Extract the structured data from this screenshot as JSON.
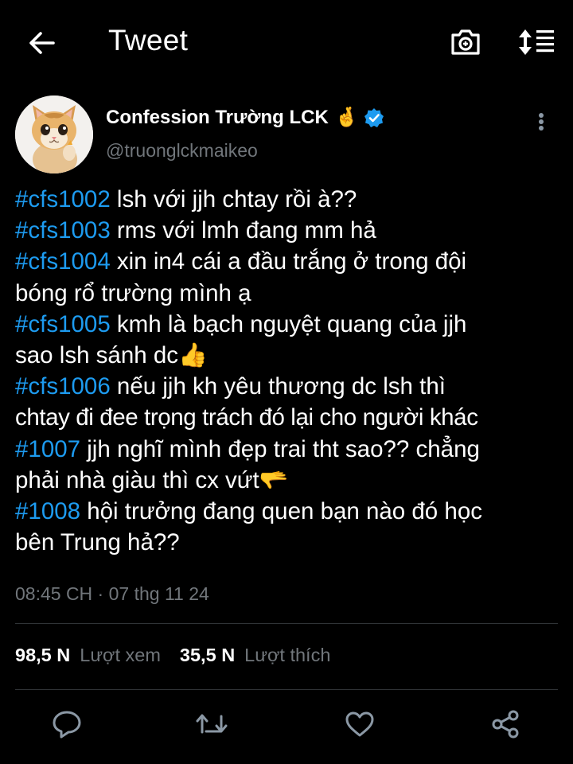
{
  "header": {
    "title": "Tweet",
    "back_icon": "arrow-left-icon",
    "camera_icon": "camera-icon",
    "sort_icon": "sort-lines-icon"
  },
  "author": {
    "display_name": "Confession Trường LCK",
    "emoji": "🤞",
    "handle": "@truonglckmaikeo",
    "verified": true,
    "verified_color": "#1d9bf0",
    "avatar_icon": "cat-avatar"
  },
  "tweet": {
    "lines": [
      {
        "tag": "#cfs1002",
        "text": " lsh với jjh chtay rồi à??"
      },
      {
        "tag": "#cfs1003",
        "text": " rms với lmh đang mm hả"
      },
      {
        "tag": "#cfs1004",
        "text": " xin in4 cái a đầu trắng ở trong đội"
      },
      {
        "tag": "",
        "text": "bóng rổ trường mình ạ"
      },
      {
        "tag": "#cfs1005",
        "text": " kmh là bạch nguyệt quang của jjh"
      },
      {
        "tag": "",
        "text": "sao lsh sánh dc👍"
      },
      {
        "tag": "#cfs1006",
        "text": " nếu jjh kh yêu thương dc lsh thì"
      },
      {
        "tag": "",
        "text": "chtay đi đee trọng trách đó lại cho người khác"
      },
      {
        "tag": "#1007",
        "text": " jjh nghĩ mình đẹp trai tht sao?? chẳng"
      },
      {
        "tag": "",
        "text": "phải nhà giàu thì cx vứt🫳"
      },
      {
        "tag": "#1008",
        "text": " hội trưởng đang quen bạn nào đó học"
      },
      {
        "tag": "",
        "text": "bên Trung hả??"
      }
    ],
    "timestamp": "08:45 CH · 07 thg 11 24"
  },
  "stats": {
    "views_count": "98,5 N",
    "views_label": "Lượt xem",
    "likes_count": "35,5 N",
    "likes_label": "Lượt thích"
  },
  "actions": [
    {
      "name": "reply-icon"
    },
    {
      "name": "retweet-icon"
    },
    {
      "name": "like-icon"
    },
    {
      "name": "share-icon"
    }
  ],
  "colors": {
    "background": "#000000",
    "hashtag": "#1d9bf0",
    "secondary_text": "#71767b",
    "divider": "#2f3336"
  }
}
